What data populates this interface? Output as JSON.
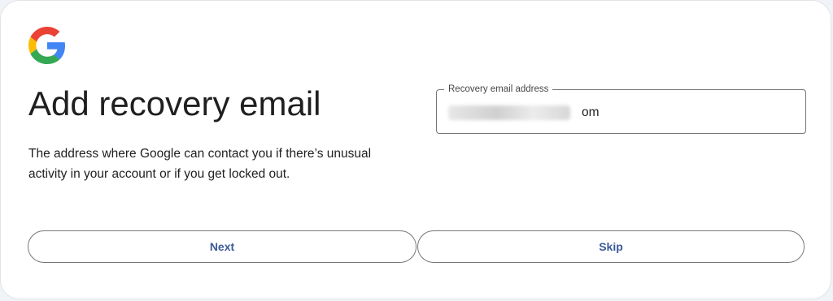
{
  "logo": {
    "icon": "google-g-icon",
    "colors": {
      "blue": "#4285F4",
      "red": "#EA4335",
      "yellow": "#FBBC05",
      "green": "#34A853"
    }
  },
  "page": {
    "title": "Add recovery email",
    "description": "The address where Google can contact you if there’s unusual activity in your account or if you get locked out."
  },
  "recovery_field": {
    "label": "Recovery email address",
    "value": "om"
  },
  "actions": {
    "next_label": "Next",
    "skip_label": "Skip"
  },
  "colors": {
    "button_text": "#3c5a9a",
    "border": "#747775",
    "text": "#1f1f1f"
  }
}
